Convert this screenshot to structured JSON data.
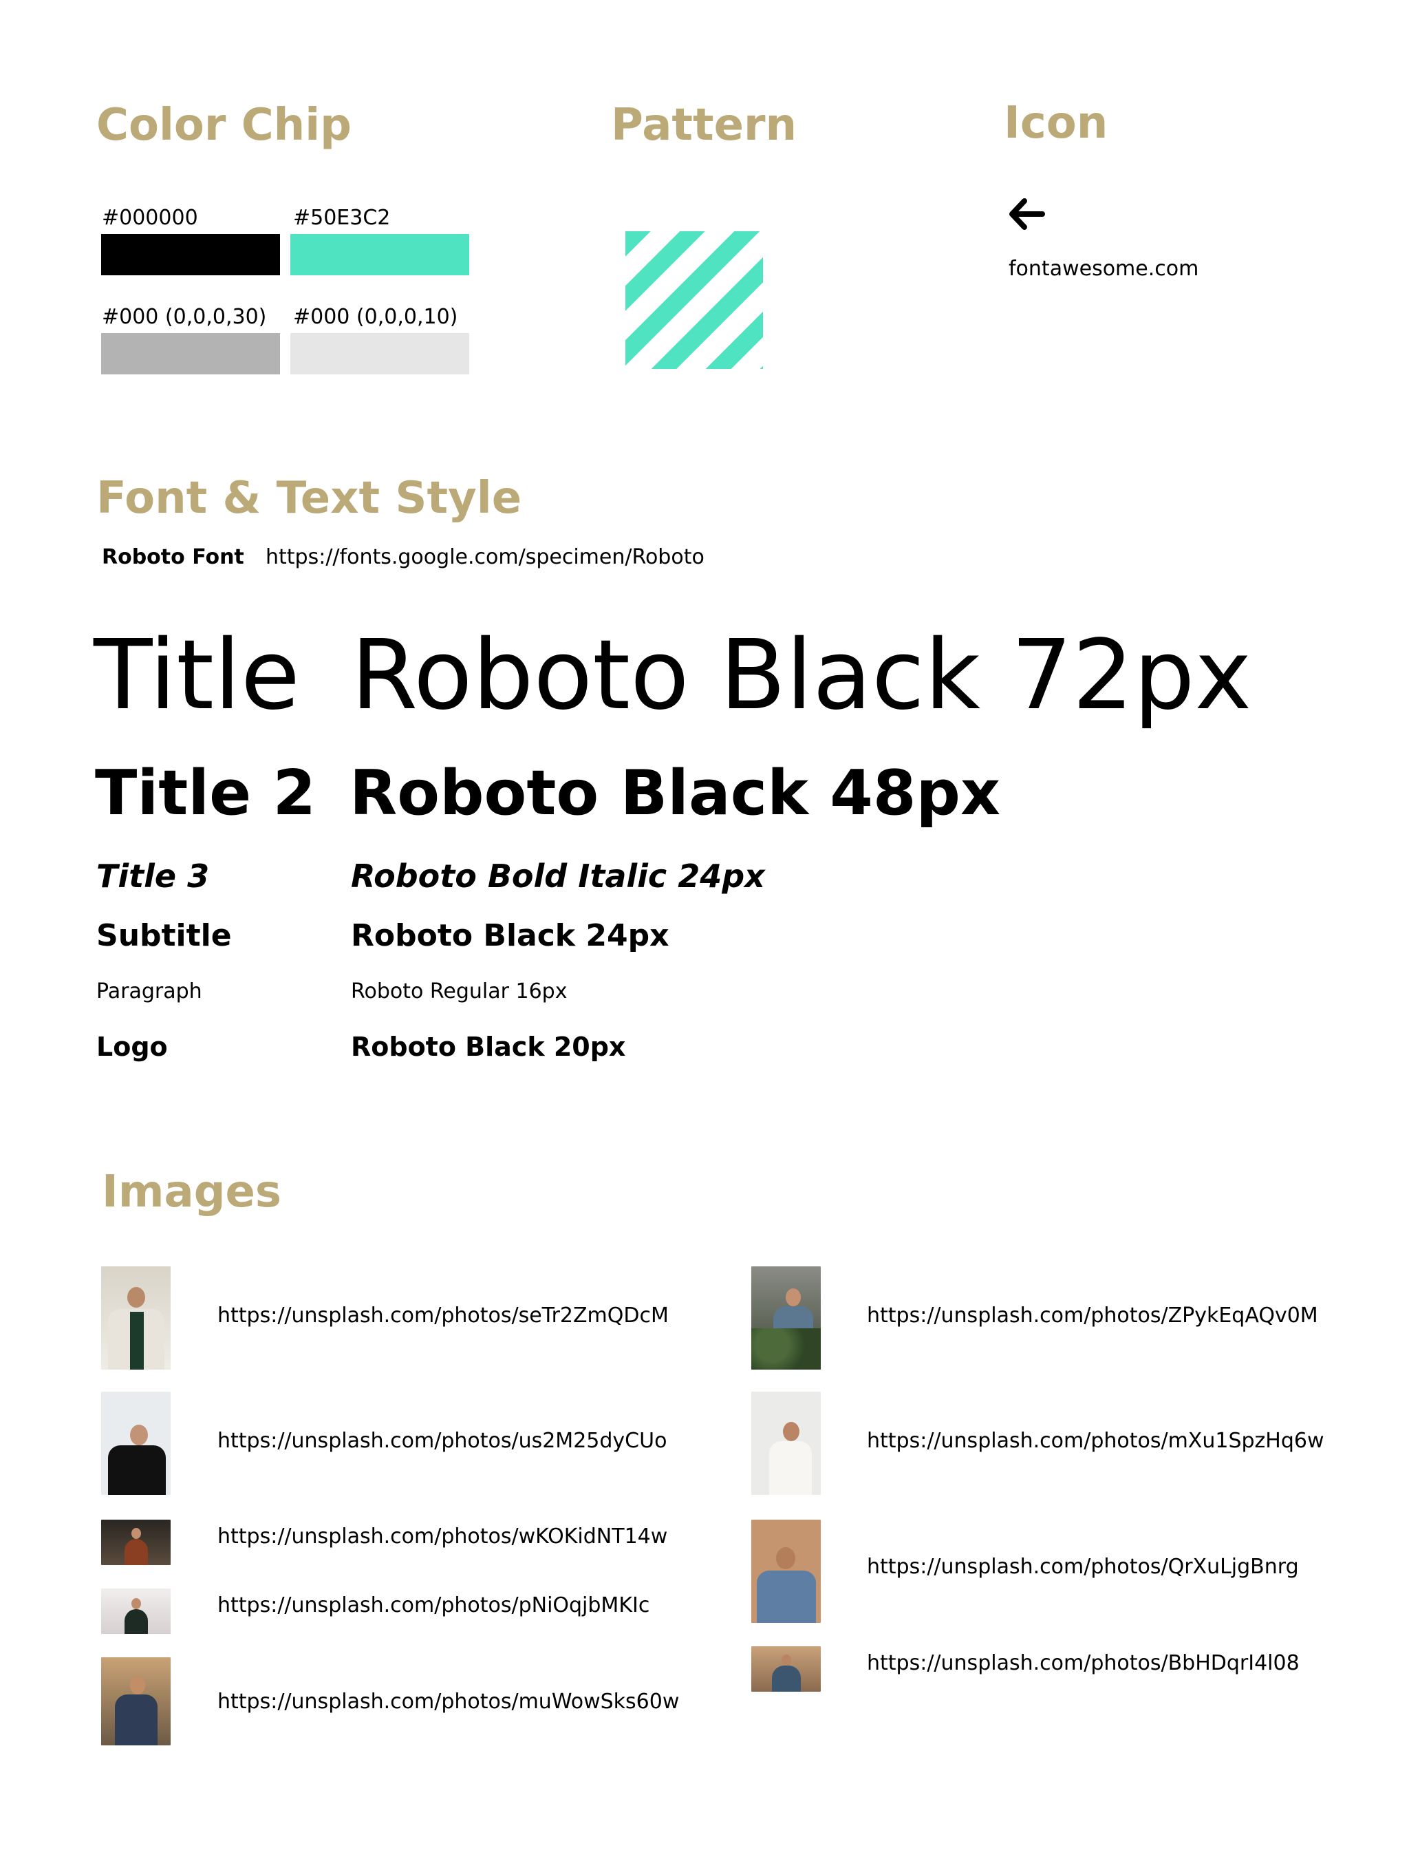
{
  "colors": {
    "heading": "#BBAA78",
    "accent": "#50E3C2"
  },
  "color_chip": {
    "title": "Color Chip",
    "chips": [
      {
        "label": "#000000",
        "color": "#000000"
      },
      {
        "label": "#50E3C2",
        "color": "#50E3C2"
      },
      {
        "label": "#000 (0,0,0,30)",
        "color": "#B3B3B3"
      },
      {
        "label": "#000 (0,0,0,10)",
        "color": "#E6E6E6"
      }
    ]
  },
  "pattern": {
    "title": "Pattern"
  },
  "icon": {
    "title": "Icon",
    "icon_name": "arrow-left-icon",
    "source": "fontawesome.com"
  },
  "font_section": {
    "title": "Font & Text Style",
    "font_name": "Roboto Font",
    "font_url": "https://fonts.google.com/specimen/Roboto",
    "styles": [
      {
        "name": "Title",
        "spec": "Roboto Black 72px"
      },
      {
        "name": "Title 2",
        "spec": "Roboto Black 48px"
      },
      {
        "name": "Title 3",
        "spec": "Roboto Bold Italic 24px"
      },
      {
        "name": "Subtitle",
        "spec": "Roboto Black 24px"
      },
      {
        "name": "Paragraph",
        "spec": "Roboto Regular 16px"
      },
      {
        "name": "Logo",
        "spec": "Roboto Black 20px"
      }
    ]
  },
  "images": {
    "title": "Images",
    "left": [
      "https://unsplash.com/photos/seTr2ZmQDcM",
      "https://unsplash.com/photos/us2M25dyCUo",
      "https://unsplash.com/photos/wKOKidNT14w",
      "https://unsplash.com/photos/pNiOqjbMKIc",
      "https://unsplash.com/photos/muWowSks60w"
    ],
    "right": [
      "https://unsplash.com/photos/ZPykEqAQv0M",
      "https://unsplash.com/photos/mXu1SpzHq6w",
      "https://unsplash.com/photos/QrXuLjgBnrg",
      "https://unsplash.com/photos/BbHDqrI4l08"
    ]
  }
}
